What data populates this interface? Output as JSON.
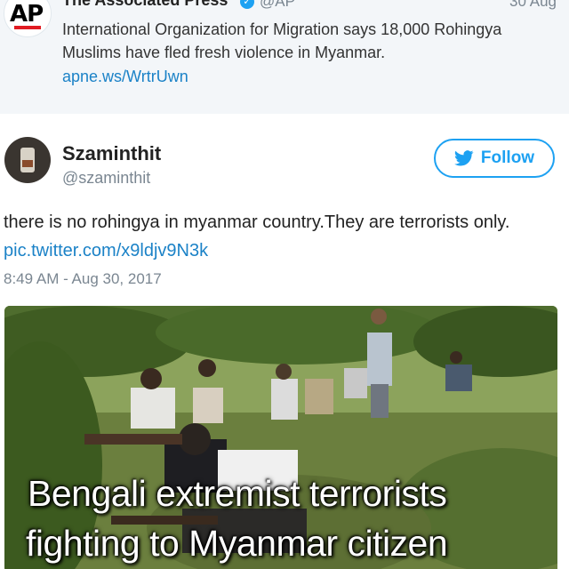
{
  "quoted_tweet": {
    "author_name": "The Associated Press",
    "author_handle": "@AP",
    "date": "30 Aug",
    "logo_text": "AP",
    "text": "International Organization for Migration says 18,000 Rohingya Muslims have fled fresh violence in Myanmar.",
    "link": "apne.ws/WrtrUwn"
  },
  "tweet": {
    "author_name": "Szaminthit",
    "author_handle": "@szaminthit",
    "follow_label": "Follow",
    "text": "there is no rohingya in myanmar country.They are terrorists only. ",
    "link": "pic.twitter.com/x9ldjv9N3k",
    "timestamp": "8:49 AM - Aug 30, 2017"
  },
  "photo": {
    "caption_line1": "Bengali extremist terrorists",
    "caption_line2": "fighting to Myanmar citizen"
  },
  "colors": {
    "accent": "#1da1f2",
    "link": "#1b82c7",
    "quoted_bg": "#f3f6f9",
    "ap_red": "#e11b22"
  },
  "icons": {
    "verified": "verified-badge-icon",
    "follow": "twitter-bird-icon"
  }
}
